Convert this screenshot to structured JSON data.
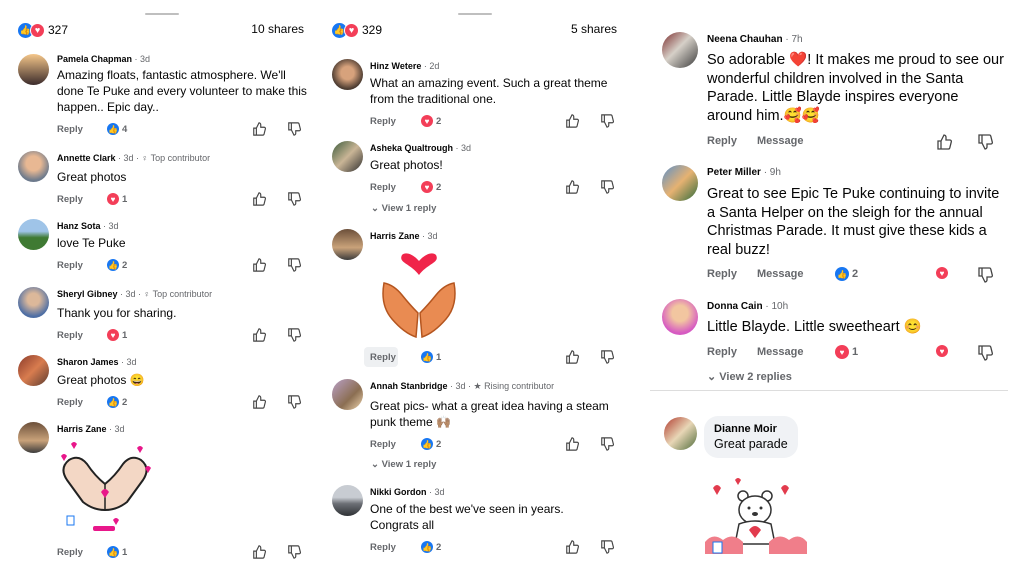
{
  "panel1": {
    "reaction_count": "327",
    "shares": "10 shares",
    "comments": [
      {
        "name": "Pamela Chapman",
        "meta": " · 3d",
        "text": "Amazing floats, fantastic atmosphere. We'll done Te Puke and every volunteer to make this happen.. Epic day..",
        "reply": "Reply",
        "count": "4",
        "reaction": "like"
      },
      {
        "name": "Annette Clark",
        "meta": " · 3d · ",
        "badge": "Top contributor",
        "text": "Great photos",
        "reply": "Reply",
        "count": "1",
        "reaction": "love"
      },
      {
        "name": "Hanz Sota",
        "meta": " · 3d",
        "text": "love Te Puke",
        "reply": "Reply",
        "count": "2",
        "reaction": "like"
      },
      {
        "name": "Sheryl Gibney",
        "meta": " · 3d · ",
        "badge": "Top contributor",
        "text": "Thank you for sharing.",
        "reply": "Reply",
        "count": "1",
        "reaction": "love"
      },
      {
        "name": "Sharon James",
        "meta": " · 3d",
        "text": "Great photos 😄",
        "reply": "Reply",
        "count": "2",
        "reaction": "like"
      },
      {
        "name": "Harris Zane",
        "meta": " · 3d",
        "text": "",
        "reply": "Reply",
        "count": "1",
        "reaction": "like"
      }
    ]
  },
  "panel2": {
    "reaction_count": "329",
    "shares": "5 shares",
    "comments": [
      {
        "name": "Hinz Wetere",
        "meta": " · 2d",
        "text": "What an amazing event. Such a great theme from the traditional one.",
        "reply": "Reply",
        "count": "2",
        "reaction": "love"
      },
      {
        "name": "Asheka Qualtrough",
        "meta": " · 3d",
        "text": "Great photos!",
        "reply": "Reply",
        "count": "2",
        "reaction": "love",
        "view_reply": "View 1 reply"
      },
      {
        "name": "Harris Zane",
        "meta": " · 3d",
        "text": "",
        "reply": "Reply",
        "count": "1",
        "reaction": "like"
      },
      {
        "name": "Annah Stanbridge",
        "meta": " · 3d · ",
        "badge": "Rising contributor",
        "text": "Great pics- what a great idea having a steam punk theme 🙌🏽",
        "reply": "Reply",
        "count": "2",
        "reaction": "like",
        "view_reply": "View 1 reply"
      },
      {
        "name": "Nikki Gordon",
        "meta": " · 3d",
        "text": "One of the best we've seen in years. Congrats all",
        "reply": "Reply",
        "count": "2",
        "reaction": "like"
      }
    ]
  },
  "panel3": {
    "comments": [
      {
        "name": "Neena Chauhan",
        "meta": " · 7h",
        "text": "So adorable ❤️! It makes me proud to see our wonderful children involved in the Santa Parade. Little Blayde inspires everyone around him.🥰🥰",
        "reply": "Reply",
        "message": "Message"
      },
      {
        "name": "Peter Miller",
        "meta": " · 9h",
        "text": "Great to see Epic Te Puke continuing to invite a Santa Helper on the sleigh for the annual Christmas Parade. It must give these kids a real buzz!",
        "reply": "Reply",
        "message": "Message",
        "count": "2",
        "reaction": "like"
      },
      {
        "name": "Donna Cain",
        "meta": " · 10h",
        "text": "Little Blayde. Little sweetheart 😊",
        "reply": "Reply",
        "message": "Message",
        "count": "1",
        "reaction": "love",
        "view_replies": "View 2 replies"
      },
      {
        "name": "Dianne Moir",
        "text": "Great parade"
      }
    ]
  },
  "colors": {
    "like_blue": "#1877f2",
    "love_red": "#f33e58",
    "meta_gray": "#65676b"
  }
}
